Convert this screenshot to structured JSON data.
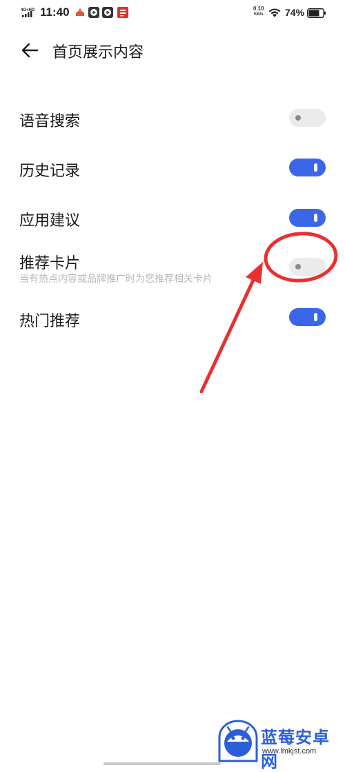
{
  "status_bar": {
    "network": "4G+HD",
    "time": "11:40",
    "speed_value": "0.10",
    "speed_unit": "KB/s",
    "battery": "74%"
  },
  "header": {
    "title": "首页展示内容"
  },
  "settings": [
    {
      "label": "语音搜索",
      "enabled": false
    },
    {
      "label": "历史记录",
      "enabled": true
    },
    {
      "label": "应用建议",
      "enabled": true
    },
    {
      "label": "推荐卡片",
      "description": "当有热点内容或品牌推广时为您推荐相关卡片",
      "enabled": false
    },
    {
      "label": "热门推荐",
      "enabled": true
    }
  ],
  "annotation": {
    "color": "#e8312f"
  },
  "watermark": {
    "name": "蓝莓安卓网",
    "url": "www.lmkjst.com"
  },
  "colors": {
    "toggle_on": "#3a67e8",
    "toggle_off": "#ebebeb"
  }
}
